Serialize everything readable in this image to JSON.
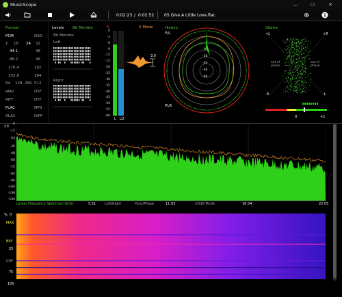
{
  "window": {
    "title": "MusicScope",
    "minimize": "—",
    "maximize": "☐",
    "close": "✕"
  },
  "toolbar": {
    "elapsed": "0:02:23",
    "separator": "/",
    "total": "0:02:52",
    "filename": "05 Give A Little Love.flac"
  },
  "format": {
    "title": "Format",
    "pcm": "PCM",
    "dsd": "DSD",
    "bits": [
      "1",
      "16",
      "24",
      "32"
    ],
    "rates_left": [
      "44.1",
      "88.2",
      "176.4",
      "352.8"
    ],
    "rates_right": [
      "48",
      "96",
      "192",
      "384"
    ],
    "dsd_rates": [
      "64",
      "128",
      "256",
      "512"
    ],
    "formats_left": [
      "WAV",
      "AIFF",
      "FLAC",
      "ALAC"
    ],
    "formats_right": [
      "DSF",
      "DFF",
      "MP3",
      "DIFF"
    ]
  },
  "levels": {
    "title": "Levels",
    "bit_monitor": "Bit Monitor",
    "bit_monitor_sub": "Bit Monitor",
    "left": "Left",
    "right": "Right"
  },
  "meter": {
    "mode_left": "S",
    "mode_right": "S-Mode",
    "scale": [
      "0",
      "-3",
      "-6",
      "-9",
      "-12",
      "-15",
      "-20",
      "-25",
      "-30",
      "-35",
      "-40",
      "-45",
      "-50",
      "-55",
      "-60"
    ],
    "left_label": "L",
    "lu_label": "LU",
    "peak": "3.0",
    "left_level": 0.84,
    "right_level": 0.55
  },
  "history": {
    "title": "History",
    "pl": "P/L",
    "plr": "PLR",
    "rings": [
      "0",
      "-10",
      "-20",
      "-30",
      "-40"
    ]
  },
  "stereo": {
    "title": "Stereo",
    "plus_l": "+L",
    "plus_r": "+R",
    "minus_l": "-L",
    "minus_r": "-R",
    "out_of_phase": "out of phase",
    "zero": "0",
    "plus_one": "+1"
  },
  "spectrum": {
    "db_label": "dB",
    "y_ticks": [
      "0",
      "-12",
      "-24",
      "-36",
      "-48",
      "-60",
      "-72",
      "-84",
      "-96",
      "-100",
      "-108",
      "-144"
    ],
    "x_ticks": [
      "5.51",
      "11.03",
      "16.54",
      "22.05"
    ],
    "linear_label": "Linear Frequency Spectrum (kHz)",
    "left_right": "Left/Right",
    "pans": "Pans/Phase",
    "mode": "-20dB Mode"
  },
  "spectrogram": {
    "pct": "%",
    "y_labels": [
      "0",
      "MAX",
      "BRY",
      "25",
      "COF",
      "75",
      "100"
    ]
  },
  "colors": {
    "green": "#45e01a",
    "orange": "#f39a2e",
    "blue": "#2a8fd0"
  }
}
